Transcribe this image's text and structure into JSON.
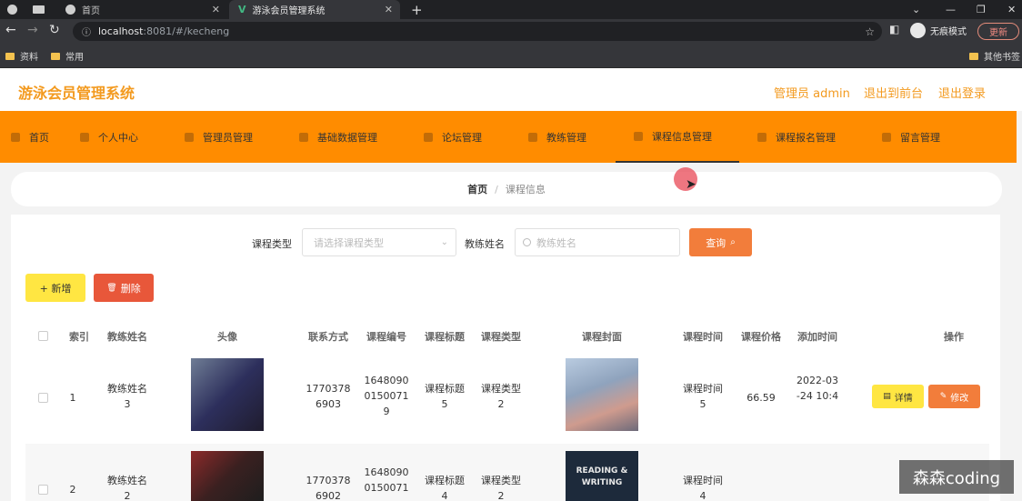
{
  "browser": {
    "tabs": [
      {
        "label": ""
      },
      {
        "label": "首页"
      },
      {
        "label": "游泳会员管理系统"
      }
    ],
    "url_host": "localhost",
    "url_path": ":8081/#/kecheng",
    "incognito_label": "无痕模式",
    "update_label": "更新",
    "bookmarks": [
      "资料",
      "常用",
      "其他书签"
    ]
  },
  "header": {
    "title": "游泳会员管理系统",
    "admin_label": "管理员 admin",
    "front_label": "退出到前台",
    "logout_label": "退出登录"
  },
  "nav": {
    "items": [
      {
        "label": "首页",
        "icon": "home-icon"
      },
      {
        "label": "个人中心",
        "icon": "user-icon"
      },
      {
        "label": "管理员管理",
        "icon": "admin-icon"
      },
      {
        "label": "基础数据管理",
        "icon": "data-icon"
      },
      {
        "label": "论坛管理",
        "icon": "forum-icon"
      },
      {
        "label": "教练管理",
        "icon": "coach-icon"
      },
      {
        "label": "课程信息管理",
        "icon": "course-icon"
      },
      {
        "label": "课程报名管理",
        "icon": "enroll-icon"
      },
      {
        "label": "留言管理",
        "icon": "message-icon"
      }
    ],
    "active_index": 6
  },
  "breadcrumb": {
    "home": "首页",
    "current": "课程信息"
  },
  "filters": {
    "type_label": "课程类型",
    "type_placeholder": "请选择课程类型",
    "coach_label": "教练姓名",
    "coach_placeholder": "教练姓名",
    "query_label": "查询"
  },
  "actions": {
    "add_label": "+ 新增",
    "delete_label": "删除"
  },
  "table": {
    "columns": [
      "索引",
      "教练姓名",
      "头像",
      "联系方式",
      "课程编号",
      "课程标题",
      "课程类型",
      "课程封面",
      "课程时间",
      "课程价格",
      "添加时间",
      "操作"
    ],
    "rows": [
      {
        "index": "1",
        "coach": [
          "教练姓名",
          "3"
        ],
        "phone": [
          "1770378",
          "6903"
        ],
        "code": [
          "1648090",
          "0150071",
          "9"
        ],
        "title": [
          "课程标题",
          "5"
        ],
        "type": [
          "课程类型",
          "2"
        ],
        "time": [
          "课程时间",
          "5"
        ],
        "price": "66.59",
        "added": [
          "2022-03",
          "-24 10:4"
        ],
        "detail": "详情",
        "edit": "修改"
      },
      {
        "index": "2",
        "coach": [
          "教练姓名",
          "2"
        ],
        "phone": [
          "1770378",
          "6902"
        ],
        "code": [
          "1648090",
          "0150071"
        ],
        "title": [
          "课程标题",
          "4"
        ],
        "type": [
          "课程类型",
          "2"
        ],
        "time": [
          "课程时间",
          "4"
        ],
        "cover_text": [
          "READING &",
          "WRITING"
        ]
      }
    ]
  },
  "watermark": "森森coding"
}
